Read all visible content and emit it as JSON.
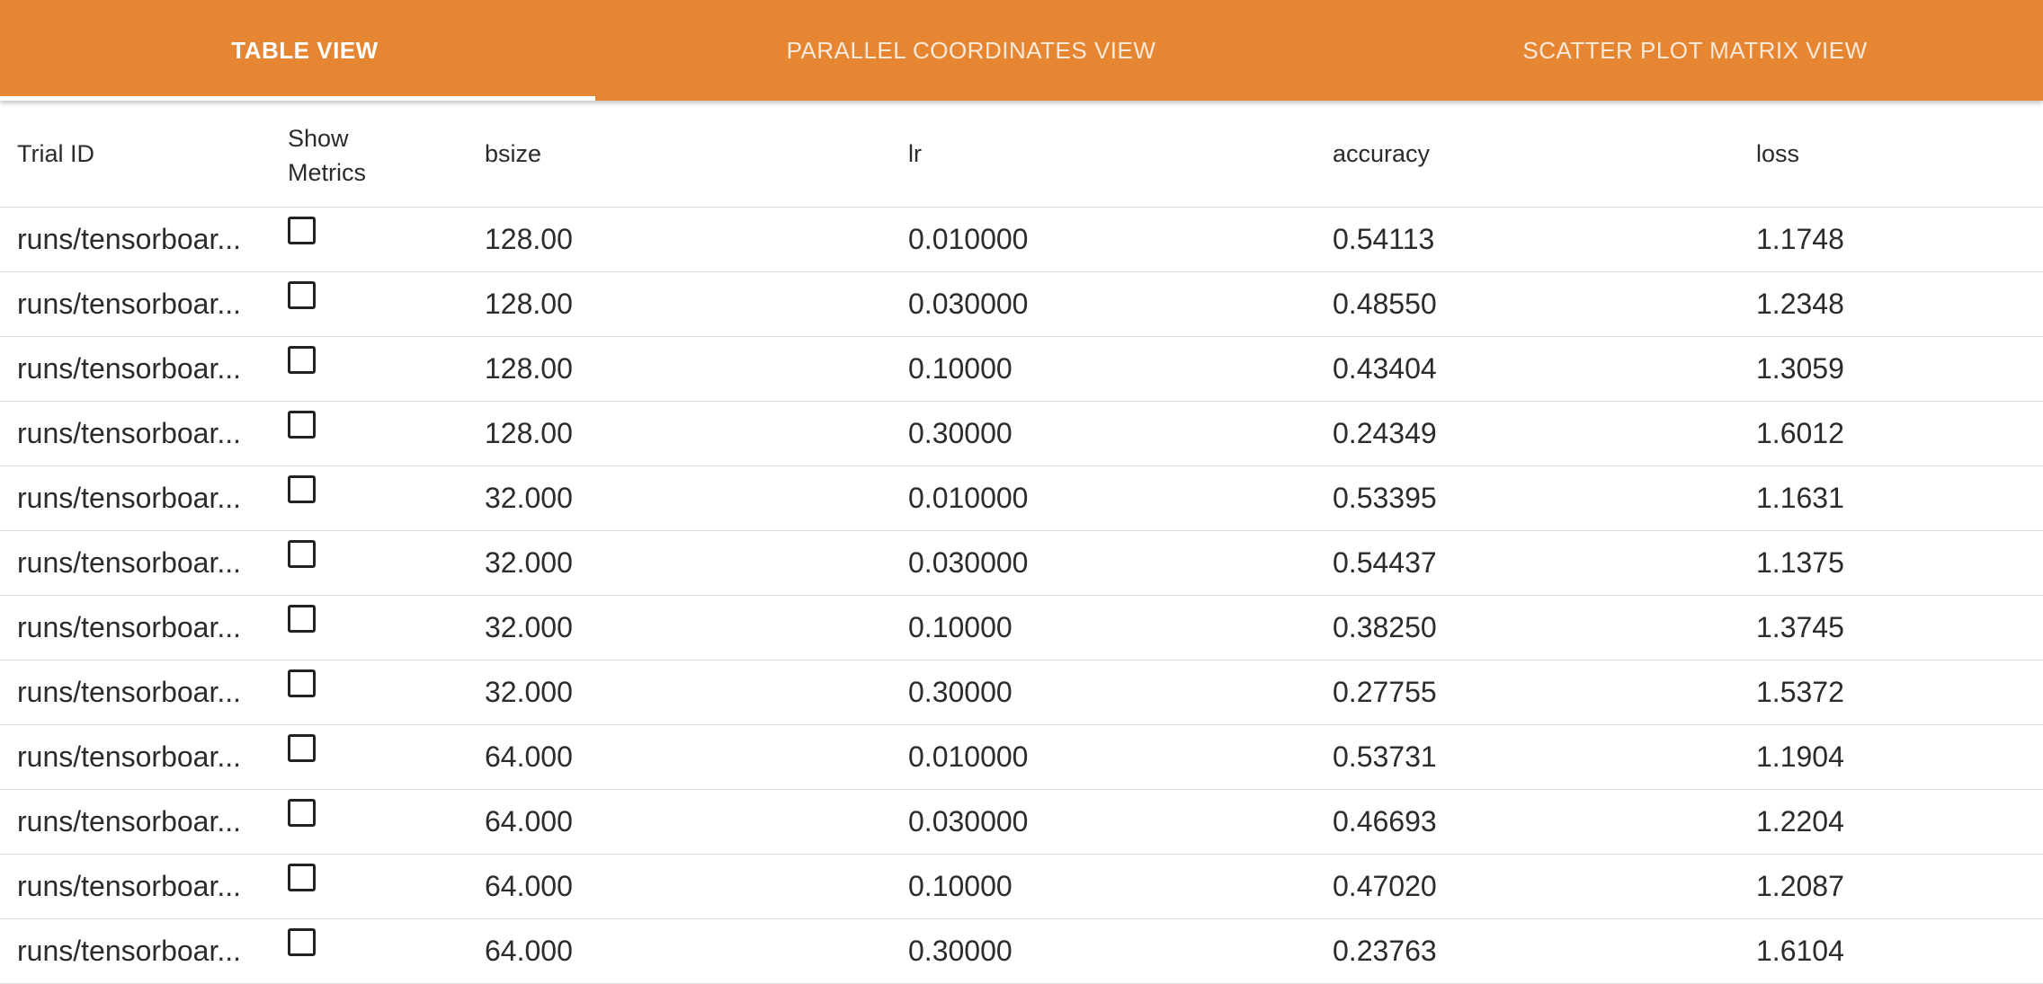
{
  "tabs": [
    {
      "label": "TABLE VIEW",
      "active": true
    },
    {
      "label": "PARALLEL COORDINATES VIEW",
      "active": false
    },
    {
      "label": "SCATTER PLOT MATRIX VIEW",
      "active": false
    }
  ],
  "accent_color": "#e68532",
  "table": {
    "headers": {
      "trial_id": "Trial ID",
      "show_metrics_line1": "Show",
      "show_metrics_line2": "Metrics",
      "bsize": "bsize",
      "lr": "lr",
      "accuracy": "accuracy",
      "loss": "loss"
    },
    "rows": [
      {
        "trial_id": "runs/tensorboar...",
        "show_metrics": false,
        "bsize": "128.00",
        "lr": "0.010000",
        "accuracy": "0.54113",
        "loss": "1.1748"
      },
      {
        "trial_id": "runs/tensorboar...",
        "show_metrics": false,
        "bsize": "128.00",
        "lr": "0.030000",
        "accuracy": "0.48550",
        "loss": "1.2348"
      },
      {
        "trial_id": "runs/tensorboar...",
        "show_metrics": false,
        "bsize": "128.00",
        "lr": "0.10000",
        "accuracy": "0.43404",
        "loss": "1.3059"
      },
      {
        "trial_id": "runs/tensorboar...",
        "show_metrics": false,
        "bsize": "128.00",
        "lr": "0.30000",
        "accuracy": "0.24349",
        "loss": "1.6012"
      },
      {
        "trial_id": "runs/tensorboar...",
        "show_metrics": false,
        "bsize": "32.000",
        "lr": "0.010000",
        "accuracy": "0.53395",
        "loss": "1.1631"
      },
      {
        "trial_id": "runs/tensorboar...",
        "show_metrics": false,
        "bsize": "32.000",
        "lr": "0.030000",
        "accuracy": "0.54437",
        "loss": "1.1375"
      },
      {
        "trial_id": "runs/tensorboar...",
        "show_metrics": false,
        "bsize": "32.000",
        "lr": "0.10000",
        "accuracy": "0.38250",
        "loss": "1.3745"
      },
      {
        "trial_id": "runs/tensorboar...",
        "show_metrics": false,
        "bsize": "32.000",
        "lr": "0.30000",
        "accuracy": "0.27755",
        "loss": "1.5372"
      },
      {
        "trial_id": "runs/tensorboar...",
        "show_metrics": false,
        "bsize": "64.000",
        "lr": "0.010000",
        "accuracy": "0.53731",
        "loss": "1.1904"
      },
      {
        "trial_id": "runs/tensorboar...",
        "show_metrics": false,
        "bsize": "64.000",
        "lr": "0.030000",
        "accuracy": "0.46693",
        "loss": "1.2204"
      },
      {
        "trial_id": "runs/tensorboar...",
        "show_metrics": false,
        "bsize": "64.000",
        "lr": "0.10000",
        "accuracy": "0.47020",
        "loss": "1.2087"
      },
      {
        "trial_id": "runs/tensorboar...",
        "show_metrics": false,
        "bsize": "64.000",
        "lr": "0.30000",
        "accuracy": "0.23763",
        "loss": "1.6104"
      }
    ]
  }
}
